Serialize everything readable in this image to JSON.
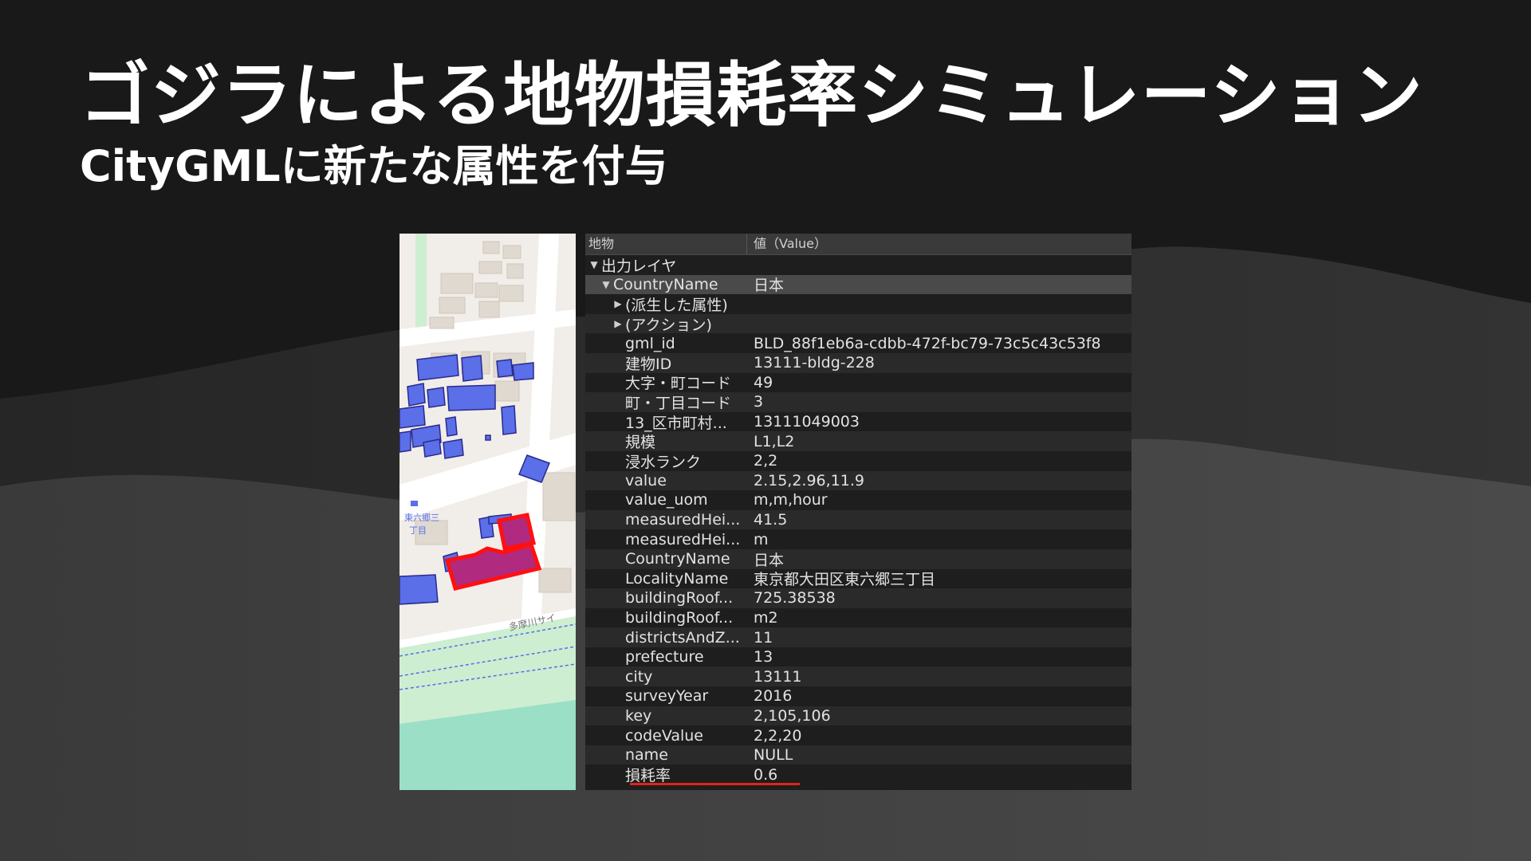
{
  "slide": {
    "title": "ゴジラによる地物損耗率シミュレーション",
    "subtitle": "CityGMLに新たな属性を付与"
  },
  "map": {
    "labels": [
      "東六郷三",
      "丁目",
      "多摩川サイ"
    ],
    "colors": {
      "background": "#f1ede8",
      "building": "#e0d9d0",
      "blue_building": "#5a6fe8",
      "selected_building": "#b02a80",
      "selected_outline": "#ff1010",
      "river_bank": "#cdeed1",
      "water": "#9bdfc6"
    }
  },
  "attributes": {
    "header": {
      "feature": "地物",
      "value": "値（Value）"
    },
    "rows": [
      {
        "indent": 0,
        "expander": "open",
        "key": "出力レイヤ",
        "value": ""
      },
      {
        "indent": 1,
        "expander": "open",
        "key": "CountryName",
        "value": "日本",
        "selected": true
      },
      {
        "indent": 2,
        "expander": "closed",
        "key": "(派生した属性)",
        "value": ""
      },
      {
        "indent": 2,
        "expander": "closed",
        "key": "(アクション)",
        "value": ""
      },
      {
        "indent": 2,
        "expander": "none",
        "key": "gml_id",
        "value": "BLD_88f1eb6a-cdbb-472f-bc79-73c5c43c53f8"
      },
      {
        "indent": 2,
        "expander": "none",
        "key": "建物ID",
        "value": "13111-bldg-228"
      },
      {
        "indent": 2,
        "expander": "none",
        "key": "大字・町コード",
        "value": "49"
      },
      {
        "indent": 2,
        "expander": "none",
        "key": "町・丁目コード",
        "value": "3"
      },
      {
        "indent": 2,
        "expander": "none",
        "key": "13_区市町村...",
        "value": "13111049003"
      },
      {
        "indent": 2,
        "expander": "none",
        "key": "規模",
        "value": "L1,L2"
      },
      {
        "indent": 2,
        "expander": "none",
        "key": "浸水ランク",
        "value": "2,2"
      },
      {
        "indent": 2,
        "expander": "none",
        "key": "value",
        "value": "2.15,2.96,11.9"
      },
      {
        "indent": 2,
        "expander": "none",
        "key": "value_uom",
        "value": "m,m,hour"
      },
      {
        "indent": 2,
        "expander": "none",
        "key": "measuredHei...",
        "value": "41.5"
      },
      {
        "indent": 2,
        "expander": "none",
        "key": "measuredHei...",
        "value": "m"
      },
      {
        "indent": 2,
        "expander": "none",
        "key": "CountryName",
        "value": "日本"
      },
      {
        "indent": 2,
        "expander": "none",
        "key": "LocalityName",
        "value": "東京都大田区東六郷三丁目"
      },
      {
        "indent": 2,
        "expander": "none",
        "key": "buildingRoof...",
        "value": "725.38538"
      },
      {
        "indent": 2,
        "expander": "none",
        "key": "buildingRoof...",
        "value": "m2"
      },
      {
        "indent": 2,
        "expander": "none",
        "key": "districtsAndZ...",
        "value": "11"
      },
      {
        "indent": 2,
        "expander": "none",
        "key": "prefecture",
        "value": "13"
      },
      {
        "indent": 2,
        "expander": "none",
        "key": "city",
        "value": "13111"
      },
      {
        "indent": 2,
        "expander": "none",
        "key": "surveyYear",
        "value": "2016"
      },
      {
        "indent": 2,
        "expander": "none",
        "key": "key",
        "value": "2,105,106"
      },
      {
        "indent": 2,
        "expander": "none",
        "key": "codeValue",
        "value": "2,2,20"
      },
      {
        "indent": 2,
        "expander": "none",
        "key": "name",
        "value": "NULL"
      },
      {
        "indent": 2,
        "expander": "none",
        "key": "損耗率",
        "value": "0.6",
        "highlight": true
      }
    ],
    "colors": {
      "highlight_underline": "#e2231a"
    }
  }
}
